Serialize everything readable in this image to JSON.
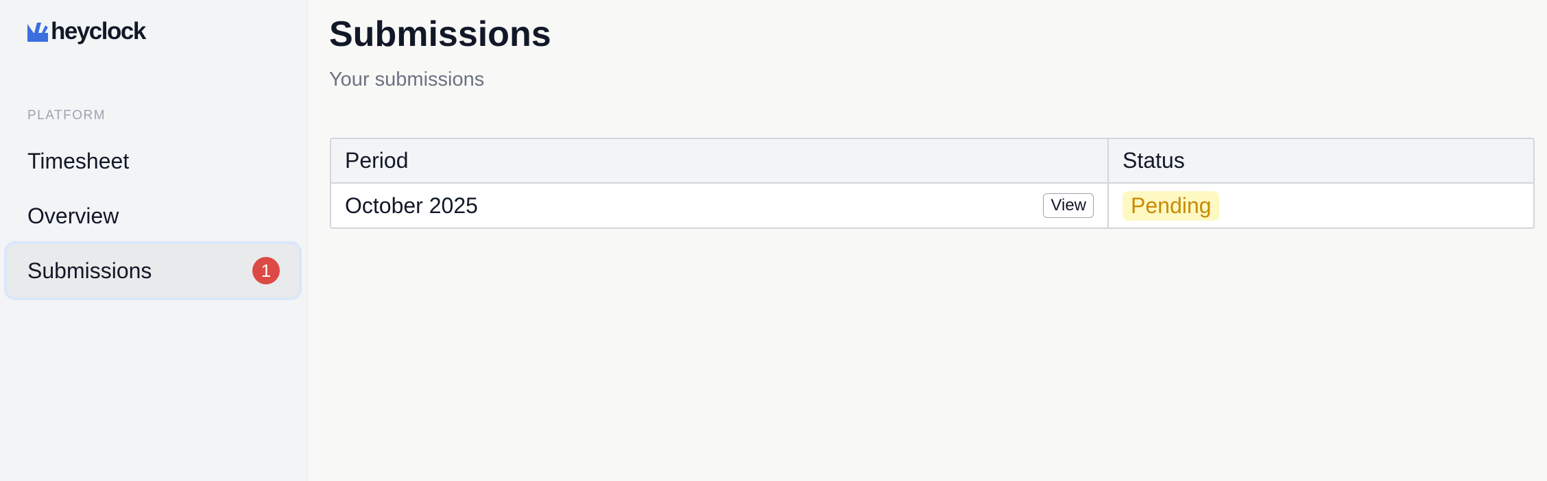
{
  "brand": {
    "name": "heyclock",
    "accent": "#3b6fe0"
  },
  "sidebar": {
    "section_label": "PLATFORM",
    "items": [
      {
        "label": "Timesheet"
      },
      {
        "label": "Overview"
      },
      {
        "label": "Submissions",
        "badge": "1"
      }
    ]
  },
  "page": {
    "title": "Submissions",
    "subtitle": "Your submissions"
  },
  "table": {
    "headers": [
      "Period",
      "Status"
    ],
    "rows": [
      {
        "period": "October 2025",
        "action": "View",
        "status": "Pending"
      }
    ]
  },
  "colors": {
    "badge": "#dc4a46",
    "pending_bg": "#fef9c3",
    "pending_text": "#ca8a04"
  }
}
